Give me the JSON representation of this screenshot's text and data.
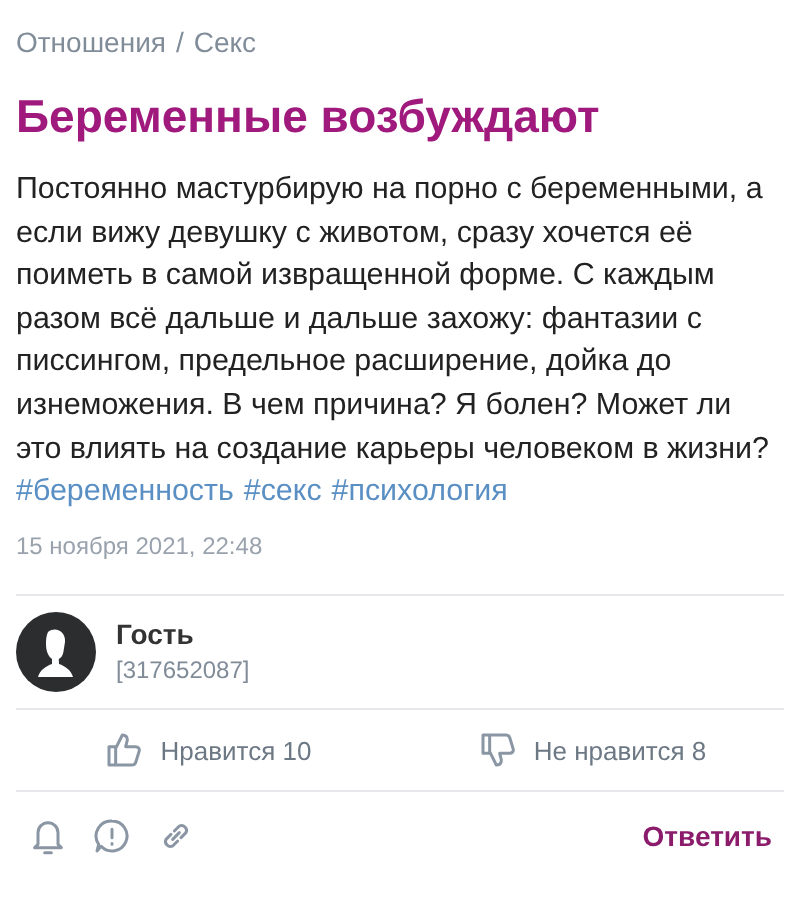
{
  "breadcrumb": [
    {
      "label": "Отношения"
    },
    {
      "label": "Секс"
    }
  ],
  "breadcrumb_separator": "/",
  "title": "Беременные возбуждают",
  "body": "Постоянно мастурбирую на порно с беременными, а если вижу девушку с животом, сразу хочется её поиметь в самой извращенной форме. С каждым разом всё дальше и дальше захожу: фантазии с писсингом, предельное расширение, дойка до изнеможения. В чем причина? Я болен? Может ли это влиять на создание карьеры человеком в жизни?",
  "hashtags": [
    "#беременность",
    "#секс",
    "#психология"
  ],
  "date": "15 ноября 2021, 22:48",
  "author": {
    "name": "Гость",
    "id": "[317652087]"
  },
  "reactions": [
    {
      "kind": "like",
      "label": "Нравится 10"
    },
    {
      "kind": "dislike",
      "label": "Не нравится 8"
    }
  ],
  "actions": [
    {
      "kind": "bell"
    },
    {
      "kind": "report"
    },
    {
      "kind": "link"
    }
  ],
  "reply_button": "Ответить"
}
